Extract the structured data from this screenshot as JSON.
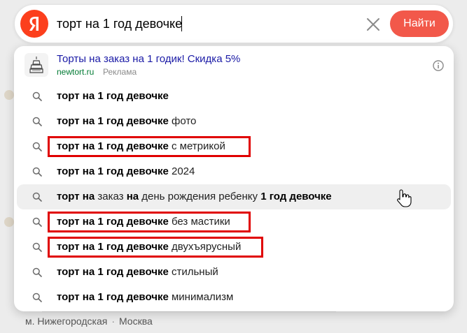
{
  "search": {
    "value": "торт на 1 год девочке",
    "find_label": "Найти"
  },
  "ad": {
    "title": "Торты на заказ на 1 годик! Скидка 5%",
    "domain": "newtort.ru",
    "label": "Реклама"
  },
  "suggestions": [
    {
      "bold": "торт на 1 год девочке",
      "rest": ""
    },
    {
      "bold": "торт на 1 год девочке",
      "rest": " фото"
    },
    {
      "bold": "торт на 1 год девочке",
      "rest": " с метрикой"
    },
    {
      "bold": "торт на 1 год девочке",
      "rest": " 2024"
    },
    {
      "parts": [
        {
          "text": "торт на",
          "bold": true
        },
        {
          "text": " заказ ",
          "bold": false
        },
        {
          "text": "на",
          "bold": true
        },
        {
          "text": " день рождения ребенку ",
          "bold": false
        },
        {
          "text": "1 год девочке",
          "bold": true
        }
      ]
    },
    {
      "bold": "торт на 1 год девочке",
      "rest": " без мастики"
    },
    {
      "bold": "торт на 1 год девочке",
      "rest": " двухъярусный"
    },
    {
      "bold": "торт на 1 год девочке",
      "rest": " стильный"
    },
    {
      "bold": "торт на 1 год девочке",
      "rest": " минимализм"
    }
  ],
  "background": {
    "footer_metro": "м. Нижегородская",
    "footer_city": "Москва"
  },
  "icons": {
    "logo": "yandex-logo",
    "clear": "close-icon",
    "suggest": "search-icon",
    "info": "info-icon",
    "cursor": "hand-pointer-icon"
  },
  "colors": {
    "brand_red": "#fc3f1d",
    "find_button": "#f2584a",
    "ad_title": "#1a1aa6",
    "ad_domain": "#007a33",
    "highlight_box": "#e00000"
  }
}
